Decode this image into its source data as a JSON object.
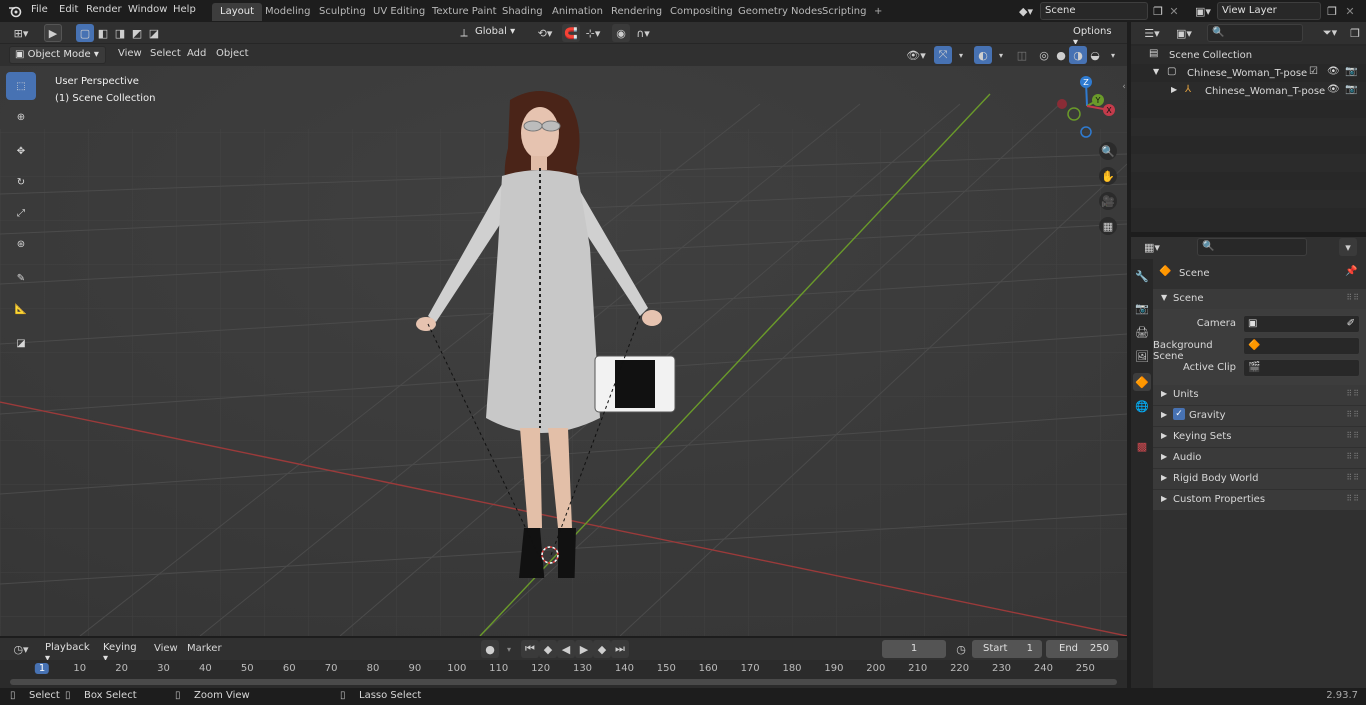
{
  "topbar": {
    "menus": [
      "File",
      "Edit",
      "Render",
      "Window",
      "Help"
    ],
    "workspaces": [
      "Layout",
      "Modeling",
      "Sculpting",
      "UV Editing",
      "Texture Paint",
      "Shading",
      "Animation",
      "Rendering",
      "Compositing",
      "Geometry Nodes",
      "Scripting"
    ],
    "active_workspace": "Layout",
    "add_tab": "+",
    "scene_name": "Scene",
    "view_layer": "View Layer"
  },
  "tool_header": {
    "orientation": "Global",
    "options": "Options"
  },
  "viewport_header": {
    "mode": "Object Mode",
    "menus": [
      "View",
      "Select",
      "Add",
      "Object"
    ]
  },
  "viewport": {
    "perspective": "User Perspective",
    "collection": "(1) Scene Collection",
    "gizmo_labels": [
      "Z",
      "Y",
      "X"
    ]
  },
  "outliner": {
    "root": "Scene Collection",
    "items": [
      {
        "label": "Chinese_Woman_T-pose"
      },
      {
        "label": "Chinese_Woman_T-pose"
      }
    ]
  },
  "properties": {
    "context": "Scene",
    "panel_title": "Scene",
    "fields": [
      {
        "label": "Camera"
      },
      {
        "label": "Background Scene"
      },
      {
        "label": "Active Clip"
      }
    ],
    "subpanels": [
      "Units",
      "Gravity",
      "Keying Sets",
      "Audio",
      "Rigid Body World",
      "Custom Properties"
    ]
  },
  "timeline": {
    "menus": [
      "Playback",
      "Keying",
      "View",
      "Marker"
    ],
    "current_frame": "1",
    "start_label": "Start",
    "start_value": "1",
    "end_label": "End",
    "end_value": "250",
    "ruler": [
      "1",
      "10",
      "20",
      "30",
      "40",
      "50",
      "60",
      "70",
      "80",
      "90",
      "100",
      "110",
      "120",
      "130",
      "140",
      "150",
      "160",
      "170",
      "180",
      "190",
      "200",
      "210",
      "220",
      "230",
      "240",
      "250"
    ]
  },
  "statusbar": {
    "items": [
      "Select",
      "Box Select",
      "Zoom View",
      "Lasso Select"
    ],
    "version": "2.93.7"
  },
  "colors": {
    "accent": "#4772b3",
    "x_axis": "#9b3a3a",
    "y_axis": "#6a9a2a",
    "z_gizmo": "#2f7bd1",
    "viewport_bg": "#3a3a3a"
  }
}
